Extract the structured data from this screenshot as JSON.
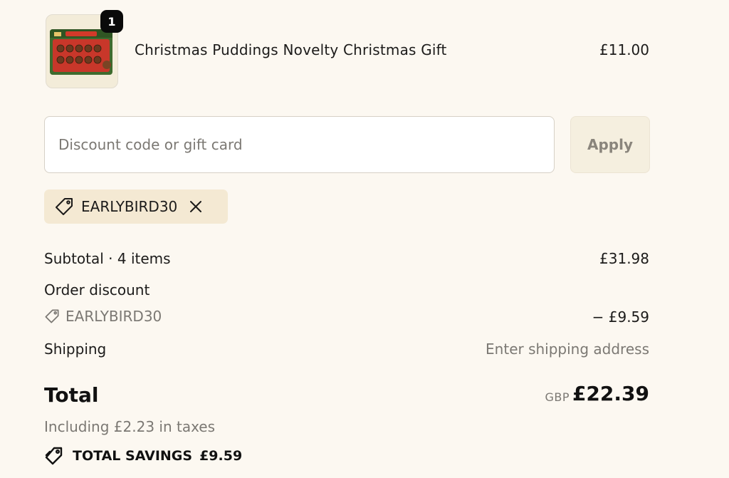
{
  "product": {
    "name": "Christmas Puddings Novelty Christmas Gift",
    "price": "£11.00",
    "quantity": "1",
    "image_icon": "christmas-puddings-box-thumbnail"
  },
  "discount": {
    "placeholder": "Discount code or gift card",
    "value": "",
    "apply_label": "Apply",
    "applied_code": "EARLYBIRD30"
  },
  "summary": {
    "subtotal_label": "Subtotal · 4 items",
    "subtotal_value": "£31.98",
    "order_discount_label": "Order discount",
    "discount_code": "EARLYBIRD30",
    "discount_value": "− £9.59",
    "shipping_label": "Shipping",
    "shipping_value": "Enter shipping address",
    "total_label": "Total",
    "currency": "GBP",
    "total_value": "£22.39",
    "tax_note": "Including £2.23 in taxes",
    "savings_label": "TOTAL SAVINGS",
    "savings_value": "£9.59"
  },
  "colors": {
    "background": "#fcf8f1",
    "chip_background": "#f4e9d3",
    "apply_background": "#f5efdf",
    "muted_text": "#7b7873"
  }
}
